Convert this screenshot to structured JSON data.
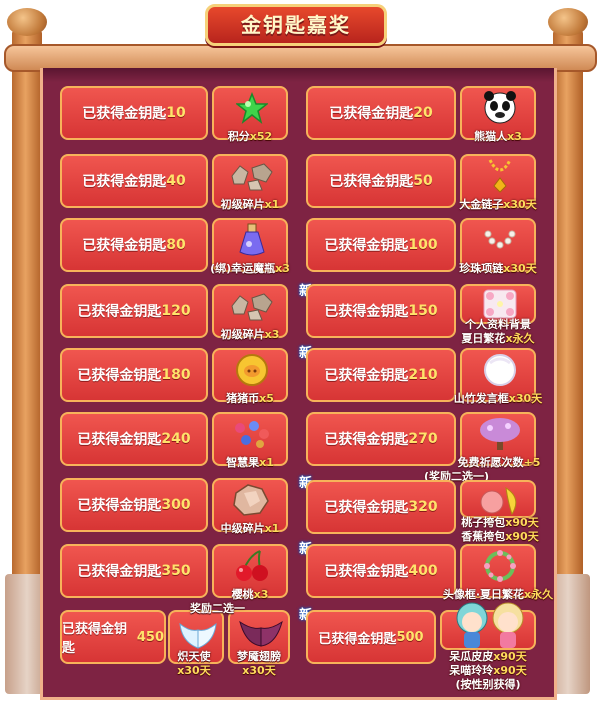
{
  "title": "金钥匙嘉奖",
  "new_badge": "新",
  "left": [
    {
      "label_prefix": "已获得金钥匙",
      "label_num": "10",
      "reward": "积分",
      "qty": "x52",
      "icon": "green-star-icon"
    },
    {
      "label_prefix": "已获得金钥匙",
      "label_num": "40",
      "reward": "初级碎片",
      "qty": "x1",
      "icon": "rock-fragment-icon"
    },
    {
      "label_prefix": "已获得金钥匙",
      "label_num": "80",
      "reward": "(绑)幸运魔瓶",
      "qty": "x3",
      "icon": "potion-bottle-icon"
    },
    {
      "label_prefix": "已获得金钥匙",
      "label_num": "120",
      "reward": "初级碎片",
      "qty": "x3",
      "icon": "rock-fragment-icon"
    },
    {
      "label_prefix": "已获得金钥匙",
      "label_num": "180",
      "reward": "猪猪币",
      "qty": "x5",
      "icon": "pig-coin-icon"
    },
    {
      "label_prefix": "已获得金钥匙",
      "label_num": "240",
      "reward": "智慧果",
      "qty": "x1",
      "icon": "wisdom-fruit-icon"
    },
    {
      "label_prefix": "已获得金钥匙",
      "label_num": "300",
      "reward": "中级碎片",
      "qty": "x1",
      "icon": "mid-fragment-icon"
    },
    {
      "label_prefix": "已获得金钥匙",
      "label_num": "350",
      "reward": "樱桃",
      "qty": "x3",
      "icon": "cherry-icon"
    },
    {
      "label_prefix": "已获得金钥匙",
      "label_num": "450",
      "note": "奖励二选一",
      "rewards": [
        {
          "name": "炽天使",
          "qty": "x30天",
          "icon": "angel-wings-icon"
        },
        {
          "name": "梦魇翅膀",
          "qty": "x30天",
          "icon": "nightmare-wings-icon"
        }
      ]
    }
  ],
  "right": [
    {
      "label_prefix": "已获得金钥匙",
      "label_num": "20",
      "reward": "熊猫人",
      "qty": "x3",
      "icon": "panda-face-icon"
    },
    {
      "label_prefix": "已获得金钥匙",
      "label_num": "50",
      "reward": "大金链子",
      "qty": "x30天",
      "icon": "gold-chain-icon"
    },
    {
      "label_prefix": "已获得金钥匙",
      "label_num": "100",
      "reward": "珍珠项链",
      "qty": "x30天",
      "icon": "pearl-necklace-icon"
    },
    {
      "label_prefix": "已获得金钥匙",
      "label_num": "150",
      "reward_line1": "个人资料背景",
      "reward": "夏日繁花",
      "qty": "x永久",
      "icon": "flower-background-icon"
    },
    {
      "label_prefix": "已获得金钥匙",
      "label_num": "210",
      "reward": "山竹发言框",
      "qty": "x30天",
      "icon": "mangosteen-bubble-icon"
    },
    {
      "label_prefix": "已获得金钥匙",
      "label_num": "270",
      "reward": "免费祈愿次数",
      "qty": "+5",
      "icon": "wish-tree-icon"
    },
    {
      "label_prefix": "已获得金钥匙",
      "label_num": "320",
      "note": "(奖励二选一)",
      "reward_line_a": "桃子挎包",
      "qty_a": "x90天",
      "reward_line_b": "香蕉挎包",
      "qty_b": "x90天",
      "icon": "fruit-bag-icon"
    },
    {
      "label_prefix": "已获得金钥匙",
      "label_num": "400",
      "reward": "头像框·夏日繁花",
      "qty": "x永久",
      "icon": "flower-wreath-icon"
    },
    {
      "label_prefix": "已获得金钥匙",
      "label_num": "500",
      "reward_line_a": "呆瓜皮皮",
      "qty_a": "x90天",
      "reward_line_b": "呆喵玲玲",
      "qty_b": "x90天",
      "reward_line_c": "(按性别获得)",
      "icon": "chibi-characters-icon"
    }
  ]
}
